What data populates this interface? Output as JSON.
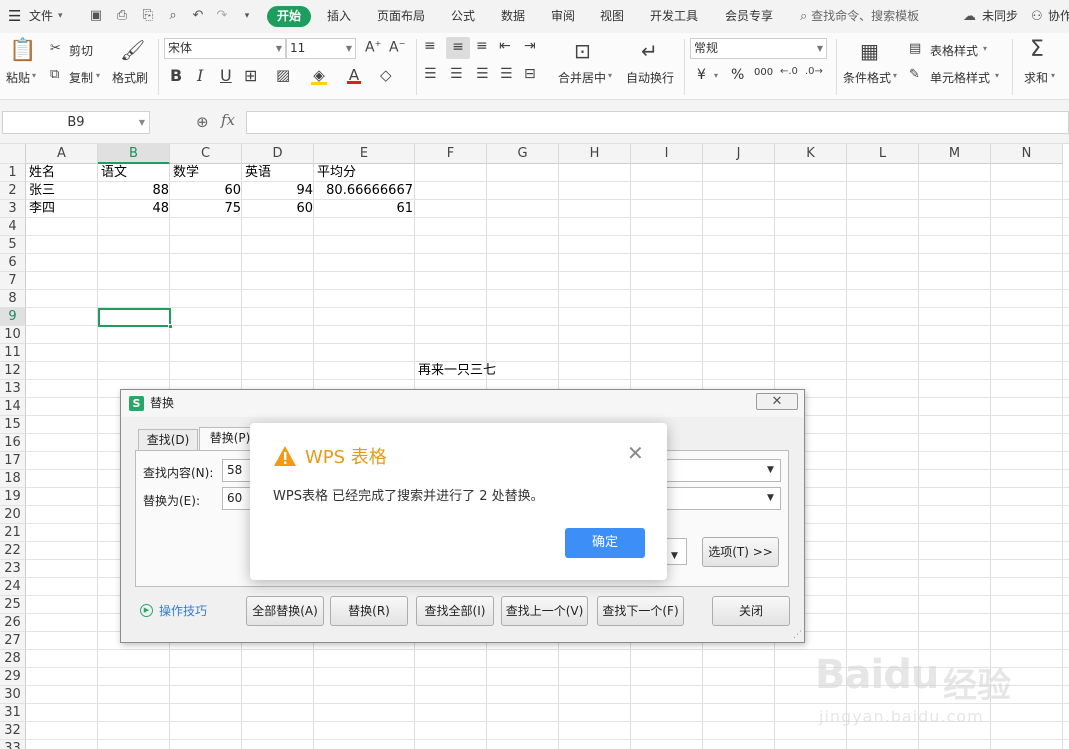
{
  "menubar": {
    "file": "文件",
    "tabs": [
      "开始",
      "插入",
      "页面布局",
      "公式",
      "数据",
      "审阅",
      "视图",
      "开发工具",
      "会员专享"
    ],
    "search": "查找命令、搜索模板",
    "sync": "未同步",
    "collab": "协作"
  },
  "ribbon": {
    "paste": "粘贴",
    "cut": "剪切",
    "copy": "复制",
    "format_painter": "格式刷",
    "font_name": "宋体",
    "font_size": "11",
    "bold": "B",
    "italic": "I",
    "underline": "U",
    "merge_center": "合并居中",
    "wrap_text": "自动换行",
    "number_format": "常规",
    "currency": "¥",
    "percent": "%",
    "thousands": "000",
    "cond_format": "条件格式",
    "table_style": "表格样式",
    "cell_style": "单元格样式",
    "sum": "求和"
  },
  "formula_bar": {
    "name_box": "B9",
    "fx": "fx",
    "value": ""
  },
  "sheet": {
    "columns": [
      "A",
      "B",
      "C",
      "D",
      "E",
      "F",
      "G",
      "H",
      "I",
      "J",
      "K",
      "L",
      "M",
      "N"
    ],
    "selected_column": "B",
    "selected_row": 9,
    "row_count": 33,
    "header_row": [
      "姓名",
      "语文",
      "数学",
      "英语",
      "平均分"
    ],
    "rows": [
      [
        "张三",
        "88",
        "60",
        "94",
        "80.66666667"
      ],
      [
        "李四",
        "48",
        "75",
        "60",
        "61"
      ]
    ],
    "note_cell": "再来一只三七"
  },
  "replace_dialog": {
    "title": "替换",
    "close": "✕",
    "tab_find": "查找(D)",
    "tab_replace": "替换(P)",
    "find_label": "查找内容(N):",
    "find_value": "58",
    "replace_label": "替换为(E):",
    "replace_value": "60",
    "options": "选项(T) >>",
    "tips": "操作技巧",
    "btn_replace_all": "全部替换(A)",
    "btn_replace": "替换(R)",
    "btn_find_all": "查找全部(I)",
    "btn_find_prev": "查找上一个(V)",
    "btn_find_next": "查找下一个(F)",
    "btn_close": "关闭"
  },
  "message_box": {
    "title": "WPS 表格",
    "message": "WPS表格 已经完成了搜索并进行了 2 处替换。",
    "ok": "确定",
    "accent_color": "#e59a1b",
    "button_color": "#3e8ef7"
  },
  "watermark": {
    "brand": "Baidu",
    "cn": "经验",
    "url": "jingyan.baidu.com"
  },
  "colors": {
    "accent_green": "#1f9d5f"
  }
}
